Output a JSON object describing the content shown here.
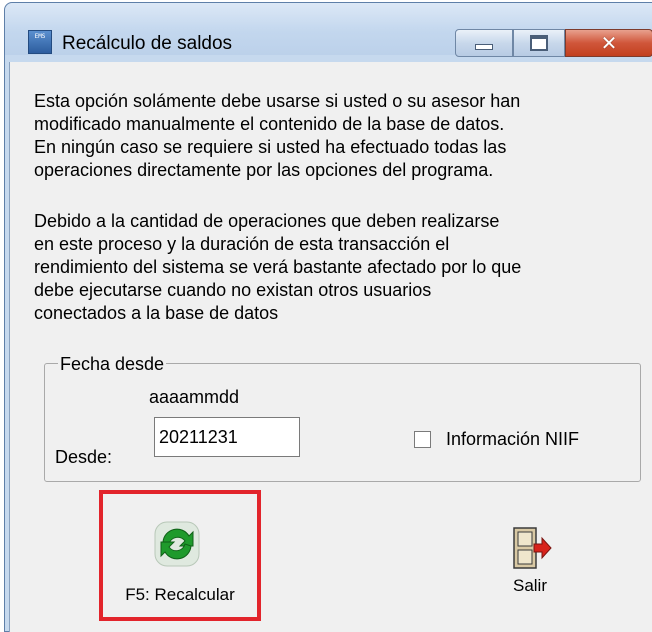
{
  "window": {
    "title": "Recálculo de saldos",
    "app_icon_text": "EMS",
    "controls": {
      "minimize": "minimize",
      "maximize": "maximize",
      "close": "✕"
    }
  },
  "body": {
    "paragraph1": "Esta opción solámente debe usarse si usted o su asesor han\nmodificado manualmente el contenido de la base de datos.\nEn ningún caso se requiere si usted ha efectuado todas las\noperaciones directamente por las opciones del programa.",
    "paragraph2": "Debido a la cantidad de operaciones que deben realizarse\nen este proceso y la duración de esta transacción el\nrendimiento del sistema se verá bastante afectado por lo que\ndebe ejecutarse cuando no existan otros usuarios\nconectados a la base de datos"
  },
  "date_group": {
    "legend": "Fecha desde",
    "format_hint": "aaaammdd",
    "desde_label": "Desde:",
    "desde_value": "20211231",
    "niif_label": "Información NIIF",
    "niif_checked": false
  },
  "actions": {
    "recalc_label": "F5: Recalcular",
    "exit_label": "Salir"
  },
  "colors": {
    "highlight_border": "#e2242b",
    "recalc_icon": "#1f9a2c",
    "exit_arrow": "#d8231c"
  }
}
